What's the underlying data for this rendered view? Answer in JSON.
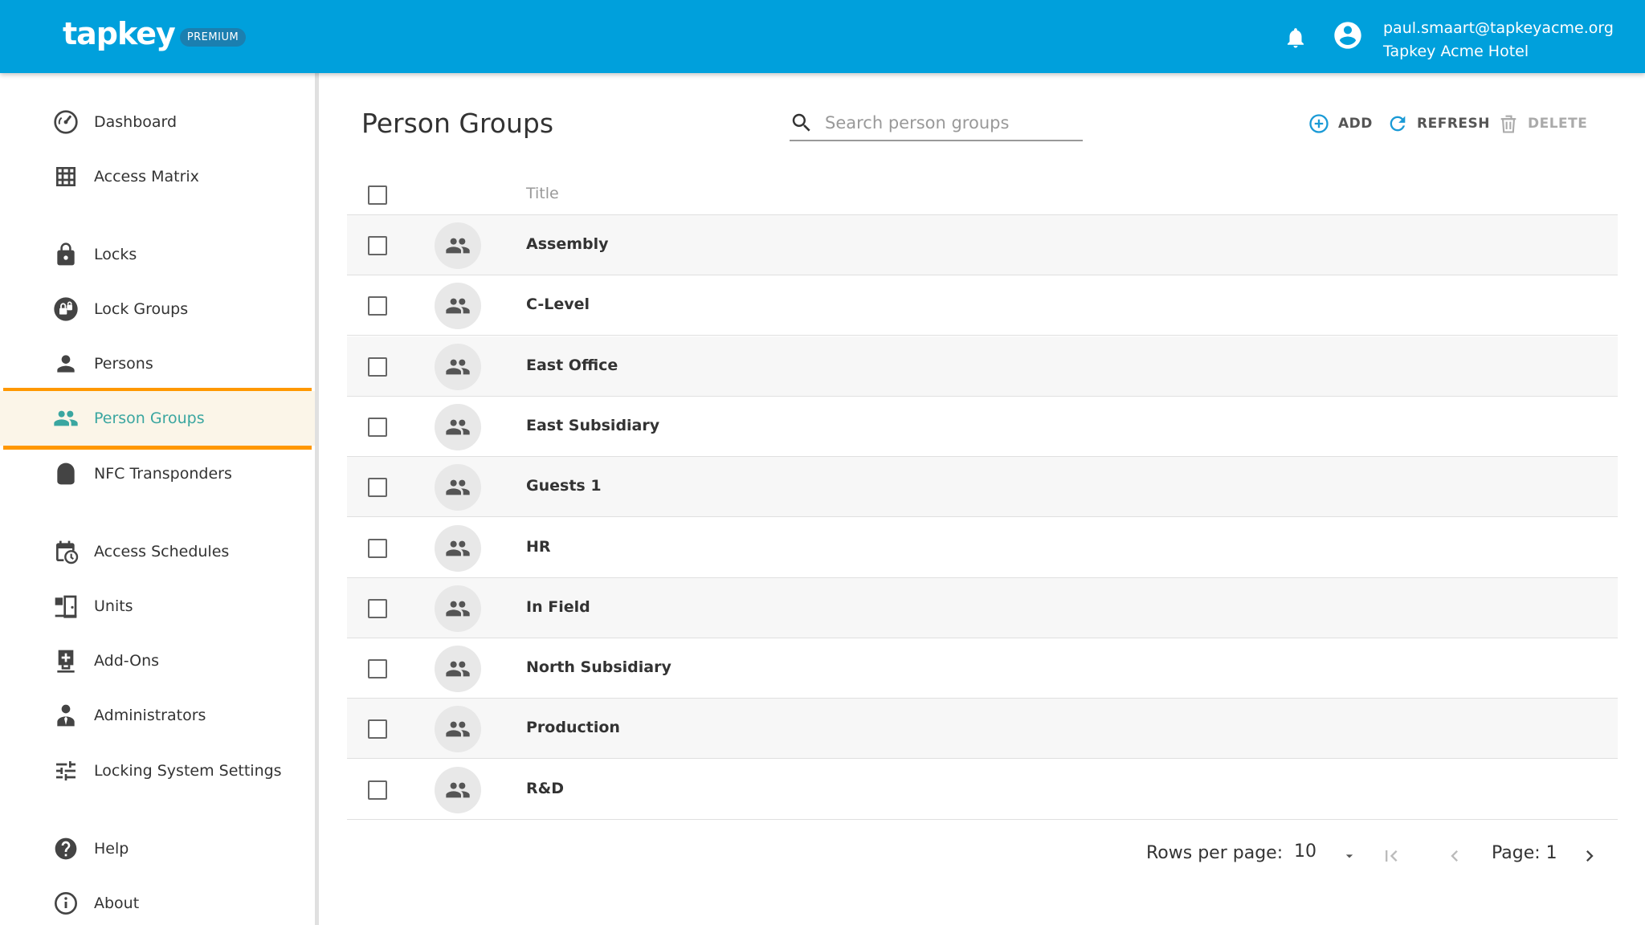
{
  "header": {
    "logo_text": "tapkey",
    "badge": "PREMIUM",
    "user_email": "paul.smaart@tapkeyacme.org",
    "user_org": "Tapkey Acme Hotel",
    "bg_color": "#00a0dc"
  },
  "sidebar": {
    "items": [
      {
        "label": "Dashboard",
        "icon": "dashboard-icon"
      },
      {
        "label": "Access Matrix",
        "icon": "grid-icon"
      },
      {
        "label": "Locks",
        "icon": "lock-icon"
      },
      {
        "label": "Lock Groups",
        "icon": "lock-group-icon"
      },
      {
        "label": "Persons",
        "icon": "person-icon"
      },
      {
        "label": "Person Groups",
        "icon": "people-icon",
        "active": true
      },
      {
        "label": "NFC Transponders",
        "icon": "nfc-transponder-icon"
      },
      {
        "label": "Access Schedules",
        "icon": "calendar-clock-icon"
      },
      {
        "label": "Units",
        "icon": "units-icon"
      },
      {
        "label": "Add-Ons",
        "icon": "add-ons-icon"
      },
      {
        "label": "Administrators",
        "icon": "admin-icon"
      },
      {
        "label": "Locking System Settings",
        "icon": "settings-sliders-icon"
      },
      {
        "label": "Help",
        "icon": "help-icon"
      },
      {
        "label": "About",
        "icon": "info-icon"
      }
    ],
    "highlight_color": "#ff9800"
  },
  "main": {
    "title": "Person Groups",
    "search_placeholder": "Search person groups",
    "toolbar": {
      "add_label": "ADD",
      "refresh_label": "REFRESH",
      "delete_label": "DELETE"
    },
    "table": {
      "column_title": "Title",
      "rows": [
        "Assembly",
        "C-Level",
        "East Office",
        "East Subsidiary",
        "Guests 1",
        "HR",
        "In Field",
        "North Subsidiary",
        "Production",
        "R&D"
      ]
    },
    "pagination": {
      "rows_per_page_label": "Rows per page:",
      "rows_per_page_value": "10",
      "page_label": "Page: 1"
    }
  }
}
